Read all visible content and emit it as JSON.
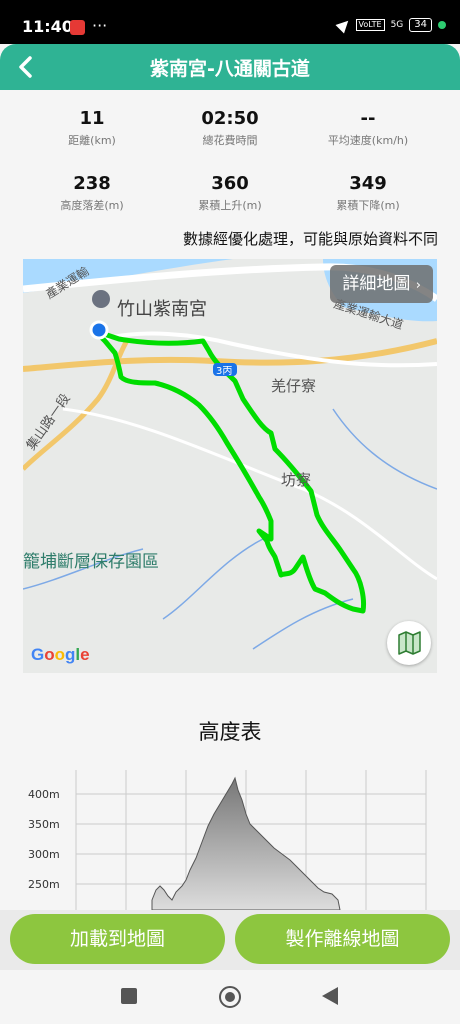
{
  "status": {
    "time": "11:40",
    "more": "···",
    "volte": "VoLTE",
    "signal": "5G",
    "battery": "34"
  },
  "header": {
    "title": "紫南宮-八通關古道"
  },
  "stats": [
    {
      "value": "11",
      "label": "距離(km)"
    },
    {
      "value": "02:50",
      "label": "總花費時間"
    },
    {
      "value": "--",
      "label": "平均速度(km/h)"
    },
    {
      "value": "238",
      "label": "高度落差(m)"
    },
    {
      "value": "360",
      "label": "累積上升(m)"
    },
    {
      "value": "349",
      "label": "累積下降(m)"
    }
  ],
  "note": "數據經優化處理，可能與原始資料不同",
  "map": {
    "detail_button": "詳細地圖",
    "labels": {
      "poi": "竹山紫南宮",
      "road_top_left": "產業運輸",
      "road_top_right": "產業運輸大道",
      "road_left": "集山路一段",
      "route_no": "3丙",
      "village1": "羌仔寮",
      "village2": "坊寮",
      "park": "籠埔斷層保存園區"
    },
    "attribution": "Google",
    "route_color": "#00dd00"
  },
  "elevation": {
    "title": "高度表",
    "y_ticks": [
      "400m",
      "350m",
      "300m",
      "250m"
    ]
  },
  "buttons": {
    "load_map": "加載到地圖",
    "offline_map": "製作離線地圖"
  }
}
